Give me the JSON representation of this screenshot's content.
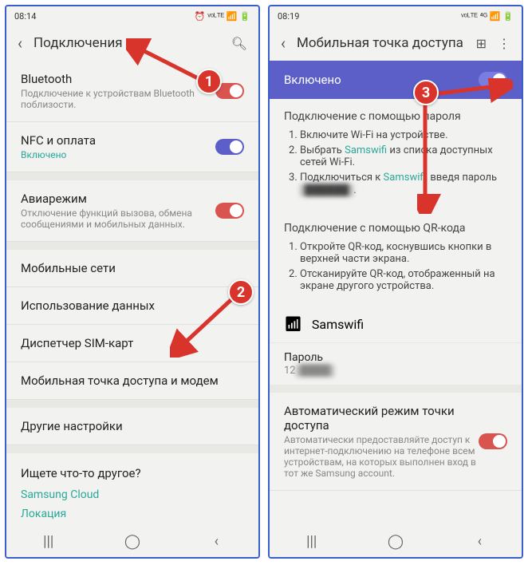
{
  "phone1": {
    "status": {
      "time": "08:14",
      "icons": "⏰ ᵛᵒᴸᵀᴱ 📶 🔋"
    },
    "header": {
      "title": "Подключения"
    },
    "items": [
      {
        "title": "Bluetooth",
        "sub": "Подключение к устройствам Bluetooth поблизости.",
        "toggle": "on-red"
      },
      {
        "title": "NFC и оплата",
        "sub": "Включено",
        "subOn": true,
        "toggle": "on-blue"
      },
      {
        "title": "Авиарежим",
        "sub": "Отключение функций вызова, обмена сообщениями и мобильных данных.",
        "toggle": "on-red"
      },
      {
        "title": "Мобильные сети"
      },
      {
        "title": "Использование данных"
      },
      {
        "title": "Диспетчер SIM-карт"
      },
      {
        "title": "Мобильная точка доступа и модем"
      },
      {
        "title": "Другие настройки"
      }
    ],
    "footer": {
      "title": "Ищете что-то другое?",
      "links": [
        "Samsung Cloud",
        "Локация"
      ]
    }
  },
  "phone2": {
    "status": {
      "time": "08:19",
      "icons": "ᵛᵒᴸᵀᴱ ⁴ᴳ 📶 🔋"
    },
    "header": {
      "title": "Мобильная точка доступа"
    },
    "enabled": {
      "label": "Включено"
    },
    "passwordSection": {
      "title": "Подключение с помощью пароля",
      "step1a": "Включите Wi-Fi на устройстве.",
      "step2a": "Выбрать ",
      "step2link": "Samswifi",
      "step2b": " из списка доступных сетей Wi-Fi.",
      "step3a": "Подключиться к ",
      "step3link": "Samswifi",
      "step3b": ", введя пароль ",
      "step3blur": "██████"
    },
    "qrSection": {
      "title": "Подключение с помощью QR-кода",
      "step1": "Откройте QR-код, коснувшись кнопки в верхней части экрана.",
      "step2": "Отсканируйте QR-код, отображенный на экране другого устройства."
    },
    "hotspot": {
      "name": "Samswifi"
    },
    "passwordField": {
      "label": "Пароль",
      "value": "12"
    },
    "autoMode": {
      "title": "Автоматический режим точки доступа",
      "sub": "Автоматически предоставляйте доступ к интернет-подключению на телефоне всем устройствам, на которых выполнен вход в тот же Samsung account."
    }
  },
  "callouts": {
    "c1": "1",
    "c2": "2",
    "c3": "3"
  }
}
